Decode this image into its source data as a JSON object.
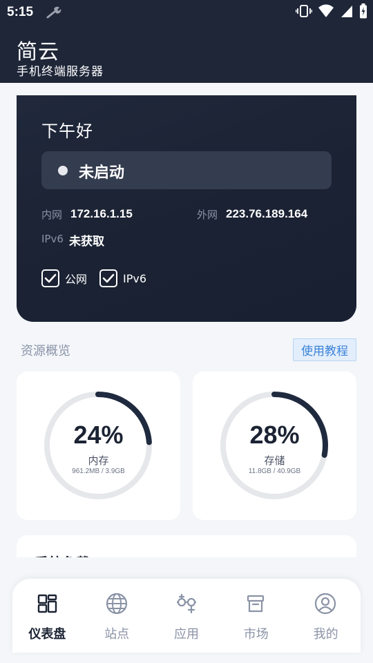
{
  "status_bar": {
    "time": "5:15",
    "icons": [
      "wrench-icon",
      "vibrate-icon",
      "wifi-icon",
      "signal-icon",
      "battery-icon"
    ]
  },
  "app_bar": {
    "title": "简云",
    "subtitle": "手机终端服务器"
  },
  "hero": {
    "greeting": "下午好",
    "server_status": "未启动",
    "intranet_label": "内网",
    "intranet_ip": "172.16.1.15",
    "public_label": "外网",
    "public_ip": "223.76.189.164",
    "ipv6_label": "IPv6",
    "ipv6_value": "未获取",
    "options": [
      {
        "label": "公网",
        "checked": true
      },
      {
        "label": "IPv6",
        "checked": true
      }
    ]
  },
  "resources": {
    "title": "资源概览",
    "tutorial_label": "使用教程",
    "memory": {
      "percent_text": "24%",
      "percent": 24,
      "label": "内存",
      "detail": "961.2MB / 3.9GB"
    },
    "storage": {
      "percent_text": "28%",
      "percent": 28,
      "label": "存储",
      "detail": "11.8GB / 40.9GB"
    }
  },
  "tasks": {
    "title": "系统负载"
  },
  "bottom_nav": {
    "items": [
      {
        "label": "仪表盘",
        "icon": "dashboard-icon",
        "active": true
      },
      {
        "label": "站点",
        "icon": "globe-icon",
        "active": false
      },
      {
        "label": "应用",
        "icon": "apps-icon",
        "active": false
      },
      {
        "label": "市场",
        "icon": "market-box-icon",
        "active": false
      },
      {
        "label": "我的",
        "icon": "profile-icon",
        "active": false
      }
    ]
  },
  "colors": {
    "primary_dark": "#1e2638",
    "accent_blue": "#3b83d8",
    "ring_track": "#e6e7ea",
    "ring_fill": "#1f2a3f"
  }
}
